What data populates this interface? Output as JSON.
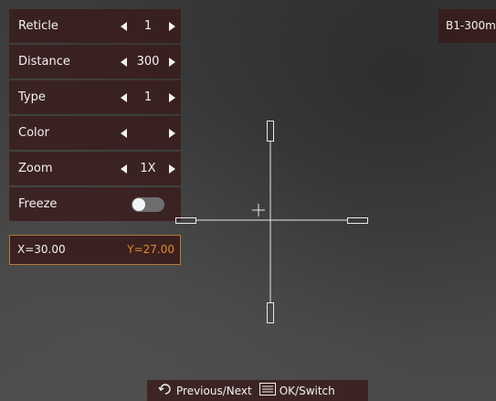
{
  "menu": {
    "reticle": {
      "label": "Reticle",
      "value": "1"
    },
    "distance": {
      "label": "Distance",
      "value": "300"
    },
    "type": {
      "label": "Type",
      "value": "1"
    },
    "color": {
      "label": "Color",
      "value_color": "#ffffff"
    },
    "zoom": {
      "label": "Zoom",
      "value": "1X"
    },
    "freeze": {
      "label": "Freeze",
      "enabled": false
    }
  },
  "coordinates": {
    "x": "X=30.00",
    "y": "Y=27.00"
  },
  "profile_badge": "B1-300m",
  "hints": {
    "previous_next": "Previous/Next",
    "ok_switch": "OK/Switch"
  },
  "colors": {
    "panel": "#3a1a1a",
    "accent": "#e08a2c",
    "reticle": "#e8e8e8"
  }
}
